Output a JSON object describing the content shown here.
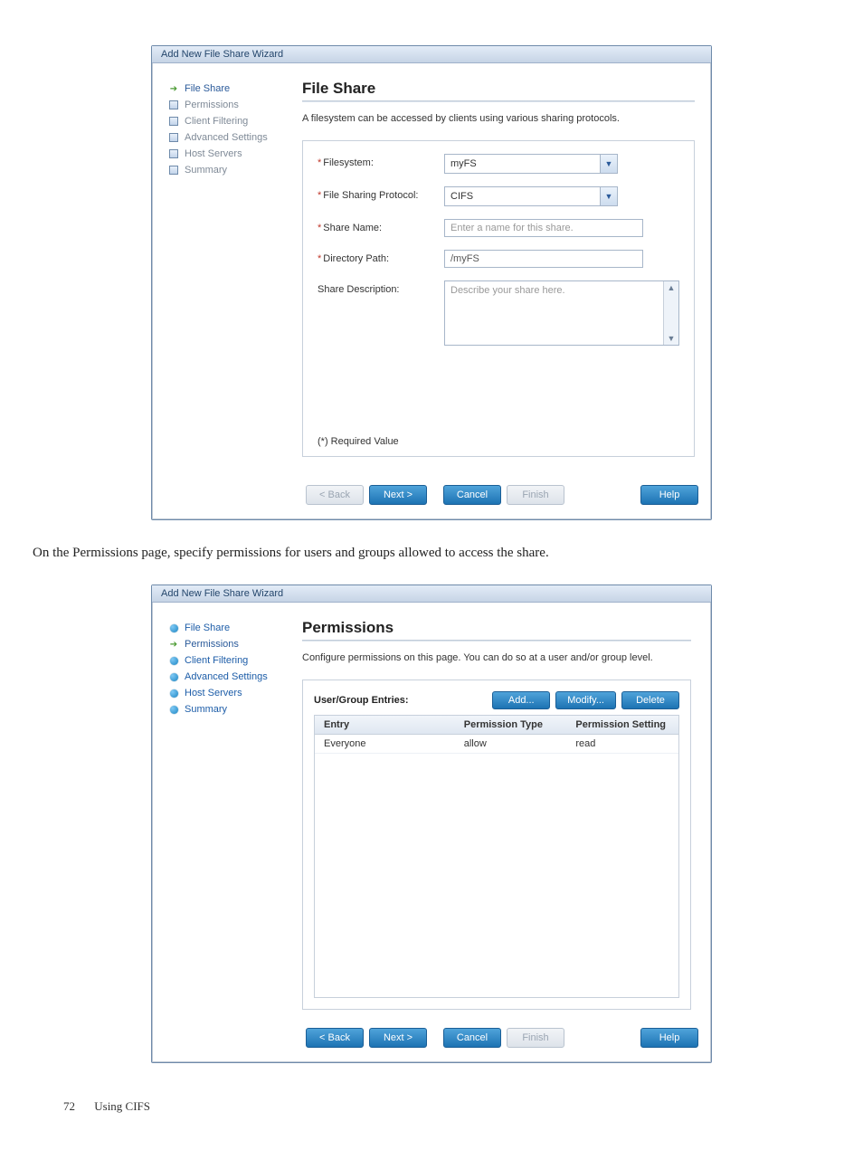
{
  "wizard_title": "Add New File Share Wizard",
  "buttons": {
    "back": "< Back",
    "next": "Next >",
    "cancel": "Cancel",
    "finish": "Finish",
    "help": "Help"
  },
  "file_share_panel": {
    "steps": [
      {
        "label": "File Share",
        "state": "current"
      },
      {
        "label": "Permissions",
        "state": "pending"
      },
      {
        "label": "Client Filtering",
        "state": "pending"
      },
      {
        "label": "Advanced Settings",
        "state": "pending"
      },
      {
        "label": "Host Servers",
        "state": "pending"
      },
      {
        "label": "Summary",
        "state": "pending"
      }
    ],
    "title": "File Share",
    "description": "A filesystem can be accessed by clients using various sharing protocols.",
    "fields": {
      "filesystem_label": "Filesystem:",
      "filesystem_value": "myFS",
      "protocol_label": "File Sharing Protocol:",
      "protocol_value": "CIFS",
      "sharename_label": "Share Name:",
      "sharename_placeholder": "Enter a name for this share.",
      "directory_label": "Directory Path:",
      "directory_value": "/myFS",
      "description_label": "Share Description:",
      "description_placeholder": "Describe your share here."
    },
    "required_note": "(*) Required Value"
  },
  "caption_between": "On the Permissions page, specify permissions for users and groups allowed to access the share.",
  "permissions_panel": {
    "steps": [
      {
        "label": "File Share",
        "state": "done"
      },
      {
        "label": "Permissions",
        "state": "current"
      },
      {
        "label": "Client Filtering",
        "state": "done"
      },
      {
        "label": "Advanced Settings",
        "state": "done"
      },
      {
        "label": "Host Servers",
        "state": "done"
      },
      {
        "label": "Summary",
        "state": "done"
      }
    ],
    "title": "Permissions",
    "description": "Configure permissions on this page. You can do so at a user and/or group level.",
    "entries_label": "User/Group Entries:",
    "entry_buttons": {
      "add": "Add...",
      "modify": "Modify...",
      "delete": "Delete"
    },
    "columns": {
      "entry": "Entry",
      "type": "Permission Type",
      "setting": "Permission Setting"
    },
    "rows": [
      {
        "entry": "Everyone",
        "type": "allow",
        "setting": "read"
      }
    ]
  },
  "page_footer": {
    "number": "72",
    "text": "Using CIFS"
  }
}
